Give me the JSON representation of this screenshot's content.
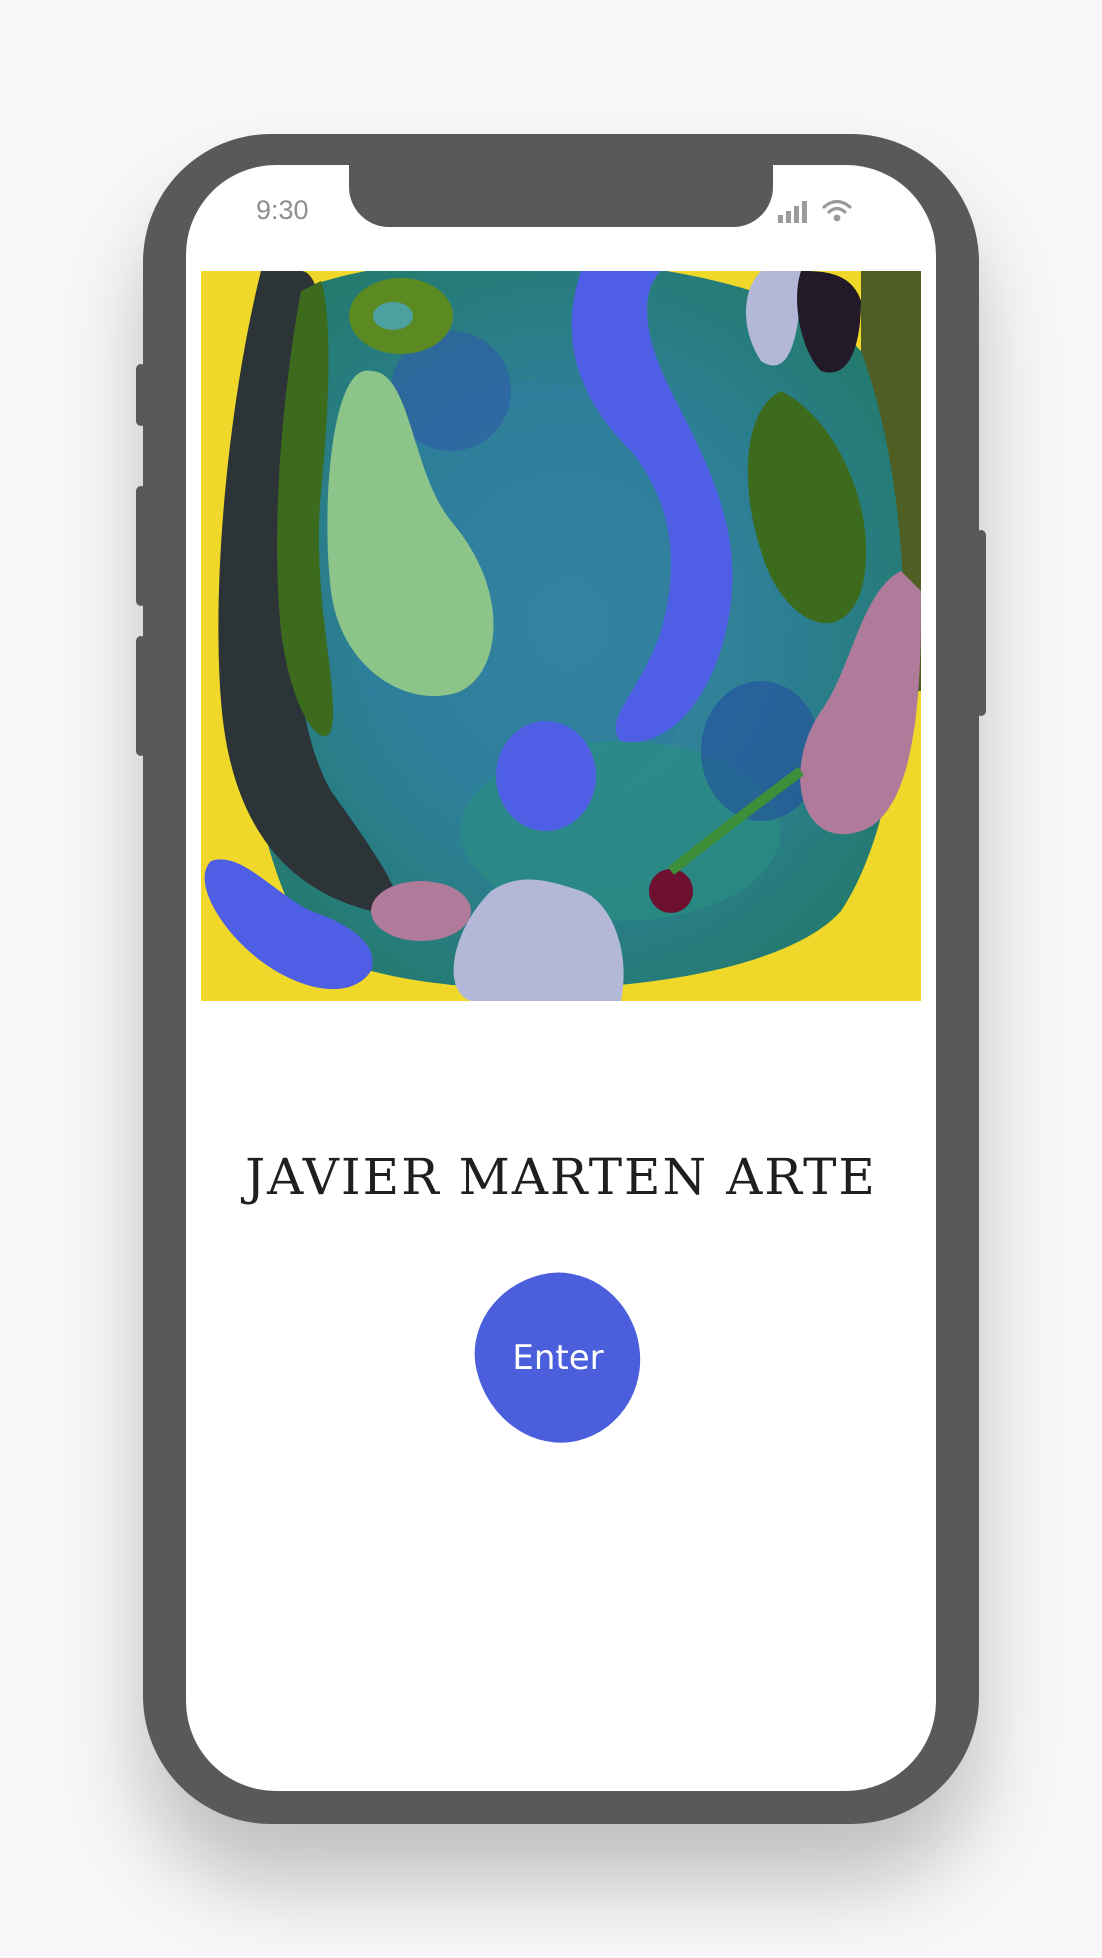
{
  "status_bar": {
    "time": "9:30",
    "icons": [
      "signal-icon",
      "wifi-icon"
    ]
  },
  "artwork": {
    "description_icon": "abstract-painting",
    "colors": {
      "yellow": "#f0d82a",
      "teal": "#2f8fa0",
      "blue": "#4e5fe6",
      "light_green": "#8dc48a",
      "dark_green": "#3d6b1e",
      "dark_slate": "#2c3438",
      "pink": "#b07a9a",
      "lavender": "#b3b8d8",
      "maroon": "#6e1030"
    }
  },
  "site": {
    "title": "JAVIER MARTEN ARTE",
    "enter_label": "Enter",
    "accent": "#4b5fdc"
  }
}
